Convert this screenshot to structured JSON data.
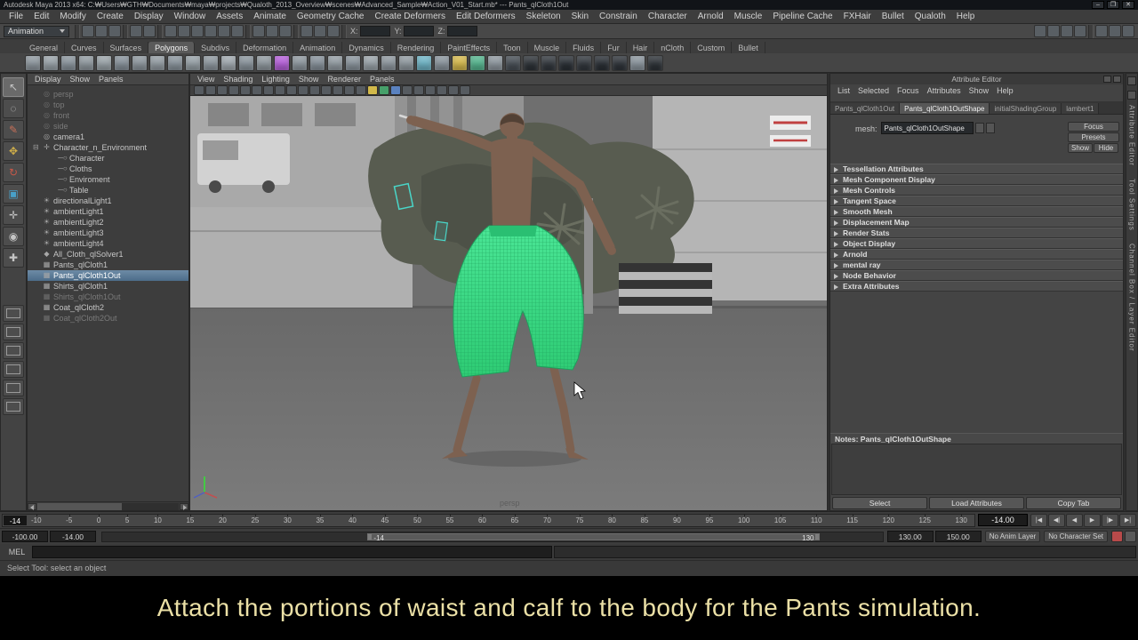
{
  "window": {
    "title": "Autodesk Maya 2013 x64: C:₩Users₩GTH₩Documents₩maya₩projects₩Qualoth_2013_Overview₩scenes₩Advanced_Sample₩Action_V01_Start.mb* --- Pants_qlCloth1Out",
    "controls": [
      {
        "name": "minimize-button",
        "glyph": "–"
      },
      {
        "name": "maximize-button",
        "glyph": "❐"
      },
      {
        "name": "close-button",
        "glyph": "✕"
      }
    ]
  },
  "menu_bar": [
    {
      "label": "File"
    },
    {
      "label": "Edit"
    },
    {
      "label": "Modify"
    },
    {
      "label": "Create"
    },
    {
      "label": "Display"
    },
    {
      "label": "Window"
    },
    {
      "label": "Assets"
    },
    {
      "label": "Animate"
    },
    {
      "label": "Geometry Cache"
    },
    {
      "label": "Create Deformers"
    },
    {
      "label": "Edit Deformers"
    },
    {
      "label": "Skeleton"
    },
    {
      "label": "Skin"
    },
    {
      "label": "Constrain"
    },
    {
      "label": "Character"
    },
    {
      "label": "Arnold"
    },
    {
      "label": "Muscle"
    },
    {
      "label": "Pipeline Cache"
    },
    {
      "label": "FXHair"
    },
    {
      "label": "Bullet"
    },
    {
      "label": "Qualoth"
    },
    {
      "label": "Help"
    }
  ],
  "status_line": {
    "menu_set": "Animation",
    "icons_a": [
      "new-scene-icon",
      "open-scene-icon",
      "save-scene-icon"
    ],
    "icons_b": [
      "undo-icon",
      "redo-icon"
    ],
    "icons_c": [
      "snap-grid-icon",
      "snap-curve-icon",
      "snap-point-icon",
      "snap-projected-center-icon",
      "snap-plane-icon",
      "snap-view-icon"
    ],
    "icons_d": [
      "input-connections-icon",
      "output-connections-icon",
      "construction-history-icon"
    ],
    "icons_e": [
      "render-current-frame-icon",
      "ipr-render-icon",
      "render-settings-icon"
    ],
    "fields": [
      {
        "label": "X:"
      },
      {
        "label": "Y:"
      },
      {
        "label": "Z:"
      }
    ],
    "icons_f": [
      "quick-selection-icon",
      "object-selection-icon",
      "component-selection-icon",
      "highlight-selection-icon"
    ],
    "icons_g": [
      "attribute-editor-toggle-icon",
      "tool-settings-toggle-icon",
      "channel-box-toggle-icon"
    ]
  },
  "shelf": {
    "tabs": [
      {
        "label": "General"
      },
      {
        "label": "Curves"
      },
      {
        "label": "Surfaces"
      },
      {
        "label": "Polygons",
        "state": "active"
      },
      {
        "label": "Subdivs"
      },
      {
        "label": "Deformation"
      },
      {
        "label": "Animation"
      },
      {
        "label": "Dynamics"
      },
      {
        "label": "Rendering"
      },
      {
        "label": "PaintEffects"
      },
      {
        "label": "Toon"
      },
      {
        "label": "Muscle"
      },
      {
        "label": "Fluids"
      },
      {
        "label": "Fur"
      },
      {
        "label": "Hair"
      },
      {
        "label": "nCloth"
      },
      {
        "label": "Custom"
      },
      {
        "label": "Bullet"
      }
    ],
    "icons": [
      "#8e979e",
      "#99a2a8",
      "#8a949c",
      "#90999f",
      "#9aa3a8",
      "#87919a",
      "#8d969d",
      "#939ca2",
      "#8a949c",
      "#96a0a6",
      "#8e979e",
      "#a0a8ae",
      "#8a949c",
      "#90999f",
      "#b561d8",
      "#8e979e",
      "#87919a",
      "#939ca2",
      "#8a949c",
      "#99a2a8",
      "#8e979e",
      "#90999f",
      "#6fb3c4",
      "#8a949c",
      "#d4b84e",
      "#56b48e",
      "#8e979e",
      "#484f56",
      "#2e3338",
      "#33383e",
      "#2b3036",
      "#33383e",
      "#2b3036",
      "#30353b",
      "#8a949c",
      "#2e3338"
    ]
  },
  "toolbox": {
    "tools": [
      {
        "name": "select-tool-icon",
        "glyph": "↖",
        "state": "active"
      },
      {
        "name": "lasso-tool-icon",
        "glyph": "◌"
      },
      {
        "name": "paint-select-tool-icon",
        "glyph": "✎",
        "c": "#c87058"
      },
      {
        "name": "move-tool-icon",
        "glyph": "✥",
        "c": "#d2b04a"
      },
      {
        "name": "rotate-tool-icon",
        "glyph": "↻",
        "c": "#c85848"
      },
      {
        "name": "scale-tool-icon",
        "glyph": "▣",
        "c": "#48a0c8"
      },
      {
        "name": "universal-manipulator-icon",
        "glyph": "✛"
      },
      {
        "name": "soft-modification-icon",
        "glyph": "◉"
      },
      {
        "name": "show-manipulator-icon",
        "glyph": "✚"
      }
    ],
    "layouts": [
      "single-pane-layout-button",
      "four-pane-layout-button",
      "two-pane-side-layout-button",
      "two-pane-stacked-layout-button",
      "persp-outliner-layout-button",
      "hypershade-layout-button"
    ]
  },
  "outliner": {
    "menus": [
      {
        "label": "Display"
      },
      {
        "label": "Show"
      },
      {
        "label": "Panels"
      }
    ],
    "items": [
      {
        "label": "persp",
        "icon": "◎",
        "cls": "dim",
        "pre": ""
      },
      {
        "label": "top",
        "icon": "◎",
        "cls": "dim",
        "pre": ""
      },
      {
        "label": "front",
        "icon": "◎",
        "cls": "dim",
        "pre": ""
      },
      {
        "label": "side",
        "icon": "◎",
        "cls": "dim",
        "pre": ""
      },
      {
        "label": "camera1",
        "icon": "◎",
        "cls": "",
        "pre": ""
      },
      {
        "label": "Character_n_Environment",
        "icon": "✛",
        "cls": "",
        "pre": "⊟"
      },
      {
        "label": "Character",
        "icon": "─○",
        "cls": "child",
        "pre": ""
      },
      {
        "label": "Cloths",
        "icon": "─○",
        "cls": "child",
        "pre": ""
      },
      {
        "label": "Enviroment",
        "icon": "─○",
        "cls": "child",
        "pre": ""
      },
      {
        "label": "Table",
        "icon": "─○",
        "cls": "child",
        "pre": ""
      },
      {
        "label": "directionalLight1",
        "icon": "☀",
        "cls": "",
        "pre": ""
      },
      {
        "label": "ambientLight1",
        "icon": "☀",
        "cls": "",
        "pre": ""
      },
      {
        "label": "ambientLight2",
        "icon": "☀",
        "cls": "",
        "pre": ""
      },
      {
        "label": "ambientLight3",
        "icon": "☀",
        "cls": "",
        "pre": ""
      },
      {
        "label": "ambientLight4",
        "icon": "☀",
        "cls": "",
        "pre": ""
      },
      {
        "label": "All_Cloth_qlSolver1",
        "icon": "◆",
        "cls": "",
        "pre": ""
      },
      {
        "label": "Pants_qlCloth1",
        "icon": "▦",
        "cls": "",
        "pre": ""
      },
      {
        "label": "Pants_qlCloth1Out",
        "icon": "▦",
        "cls": "selected",
        "pre": ""
      },
      {
        "label": "Shirts_qlCloth1",
        "icon": "▦",
        "cls": "",
        "pre": ""
      },
      {
        "label": "Shirts_qlCloth1Out",
        "icon": "▦",
        "cls": "dim",
        "pre": ""
      },
      {
        "label": "Coat_qlCloth2",
        "icon": "▦",
        "cls": "",
        "pre": ""
      },
      {
        "label": "Coat_qlCloth2Out",
        "icon": "▦",
        "cls": "dim",
        "pre": ""
      }
    ]
  },
  "viewport": {
    "menus": [
      {
        "label": "View"
      },
      {
        "label": "Shading"
      },
      {
        "label": "Lighting"
      },
      {
        "label": "Show"
      },
      {
        "label": "Renderer"
      },
      {
        "label": "Panels"
      }
    ],
    "toolbar": [
      {
        "name": "select-camera-icon"
      },
      {
        "name": "lock-camera-icon"
      },
      {
        "name": "camera-attributes-icon"
      },
      {
        "name": "bookmarks-icon"
      },
      {
        "name": "image-plane-icon"
      },
      {
        "name": "view-grid-icon"
      },
      {
        "name": "film-gate-icon"
      },
      {
        "name": "resolution-gate-icon"
      },
      {
        "name": "gate-mask-icon"
      },
      {
        "name": "field-chart-icon"
      },
      {
        "name": "safe-action-icon"
      },
      {
        "name": "safe-title-icon"
      },
      {
        "name": "wireframe-mode-icon"
      },
      {
        "name": "shaded-mode-icon"
      },
      {
        "name": "textured-mode-icon"
      },
      {
        "name": "use-all-lights-icon",
        "c": "#d2b94a"
      },
      {
        "name": "shadows-icon",
        "c": "#46a06a"
      },
      {
        "name": "screen-space-ao-icon",
        "c": "#5a82c0"
      },
      {
        "name": "motion-blur-icon"
      },
      {
        "name": "multisample-aa-icon"
      },
      {
        "name": "xray-icon"
      },
      {
        "name": "isolate-select-icon"
      },
      {
        "name": "exposure-icon"
      },
      {
        "name": "gamma-icon"
      }
    ],
    "camera_label": "persp"
  },
  "attribute_editor": {
    "title": "Attribute Editor",
    "menus": [
      {
        "label": "List"
      },
      {
        "label": "Selected"
      },
      {
        "label": "Focus"
      },
      {
        "label": "Attributes"
      },
      {
        "label": "Show"
      },
      {
        "label": "Help"
      }
    ],
    "tabs": [
      {
        "label": "Pants_qlCloth1Out"
      },
      {
        "label": "Pants_qlCloth1OutShape",
        "state": "active"
      },
      {
        "label": "initialShadingGroup"
      },
      {
        "label": "lambert1"
      }
    ],
    "mesh_label": "mesh:",
    "mesh_value": "Pants_qlCloth1OutShape",
    "focus_button": "Focus",
    "presets_button": "Presets",
    "show_button": "Show",
    "hide_button": "Hide",
    "sections": [
      {
        "label": "Tessellation Attributes"
      },
      {
        "label": "Mesh Component Display"
      },
      {
        "label": "Mesh Controls"
      },
      {
        "label": "Tangent Space"
      },
      {
        "label": "Smooth Mesh"
      },
      {
        "label": "Displacement Map"
      },
      {
        "label": "Render Stats"
      },
      {
        "label": "Object Display"
      },
      {
        "label": "Arnold"
      },
      {
        "label": "mental ray"
      },
      {
        "label": "Node Behavior"
      },
      {
        "label": "Extra Attributes"
      }
    ],
    "notes_label": "Notes: Pants_qlCloth1OutShape",
    "buttons": [
      {
        "label": "Select",
        "name": "select-button"
      },
      {
        "label": "Load Attributes",
        "name": "load-attributes-button"
      },
      {
        "label": "Copy Tab",
        "name": "copy-tab-button"
      }
    ]
  },
  "right_strip": {
    "tabs": [
      {
        "label": "Attribute Editor"
      },
      {
        "label": "Tool Settings"
      },
      {
        "label": "Channel Box / Layer Editor"
      }
    ]
  },
  "time_slider": {
    "ticks": [
      "-10",
      "-5",
      "0",
      "5",
      "10",
      "15",
      "20",
      "25",
      "30",
      "35",
      "40",
      "45",
      "50",
      "55",
      "60",
      "65",
      "70",
      "75",
      "80",
      "85",
      "90",
      "95",
      "100",
      "105",
      "110",
      "115",
      "120",
      "125",
      "130"
    ],
    "current_frame": "-14",
    "current_time": "-14.00",
    "transport": [
      {
        "name": "go-to-start-button",
        "glyph": "|◀"
      },
      {
        "name": "step-back-button",
        "glyph": "◀|"
      },
      {
        "name": "play-backwards-button",
        "glyph": "◀"
      },
      {
        "name": "play-forward-button",
        "glyph": "▶"
      },
      {
        "name": "step-forward-button",
        "glyph": "|▶"
      },
      {
        "name": "go-to-end-button",
        "glyph": "▶|"
      }
    ]
  },
  "range_slider": {
    "start": "-100.00",
    "playback_start": "-14.00",
    "bar_start": "-14",
    "bar_end": "130",
    "playback_end": "130.00",
    "end": "150.00",
    "anim_layer": "No Anim Layer",
    "character_set": "No Character Set",
    "icons": [
      {
        "name": "auto-keyframe-button",
        "c": "#b84a4a"
      },
      {
        "name": "animation-preferences-button",
        "c": "#5a5a5a"
      }
    ]
  },
  "command_line": {
    "label": "MEL"
  },
  "help_line": {
    "text": "Select Tool: select an object"
  },
  "caption": {
    "text": "Attach the portions of waist and calf to the body for the Pants simulation.",
    "style": "color:#ebe0a6"
  },
  "colors": {
    "pants_green": "#3fd987",
    "selection_highlight": "#5d7e9c",
    "caption_text": "#ebe0a6"
  }
}
